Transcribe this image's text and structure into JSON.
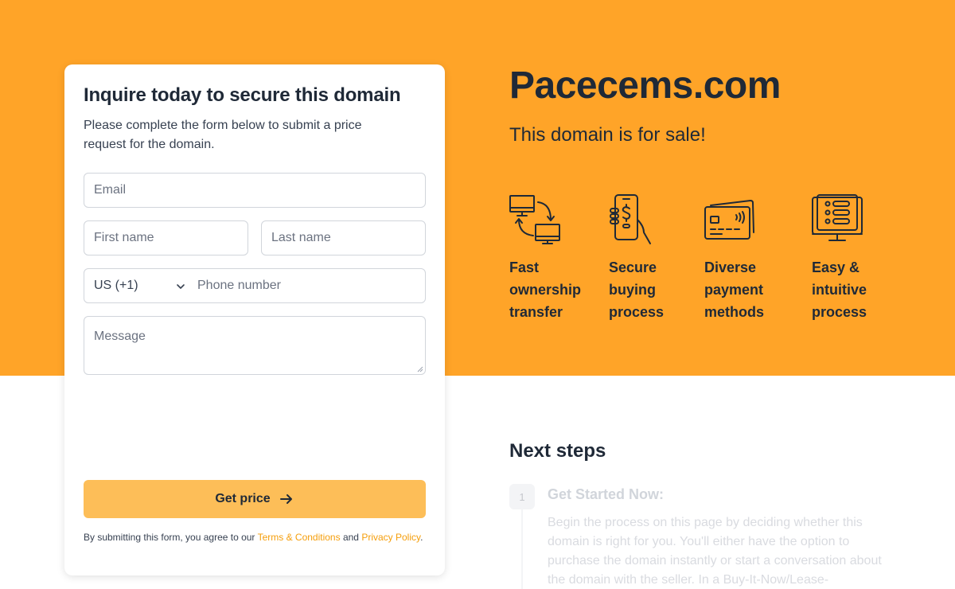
{
  "colors": {
    "hero": "#ffa428",
    "button": "#fdbe58",
    "link": "#f59e0b",
    "text": "#1f2937"
  },
  "form": {
    "title": "Inquire today to secure this domain",
    "subtitle": "Please complete the form below to submit a price request for the domain.",
    "email_placeholder": "Email",
    "first_name_placeholder": "First name",
    "last_name_placeholder": "Last name",
    "country_code": "US (+1)",
    "phone_placeholder": "Phone number",
    "message_placeholder": "Message",
    "submit_label": "Get price",
    "legal": {
      "prefix": "By submitting this form, you agree to our ",
      "terms": "Terms & Conditions",
      "and": " and ",
      "privacy": "Privacy Policy",
      "suffix": "."
    }
  },
  "hero": {
    "domain": "Pacecems.com",
    "tagline": "This domain is for sale!",
    "features": [
      {
        "icon": "transfer-icon",
        "label": "Fast ownership transfer"
      },
      {
        "icon": "secure-phone-icon",
        "label": "Secure buying process"
      },
      {
        "icon": "credit-card-icon",
        "label": "Diverse payment methods"
      },
      {
        "icon": "monitor-list-icon",
        "label": "Easy & intuitive process"
      }
    ]
  },
  "next_steps": {
    "title": "Next steps",
    "steps": [
      {
        "number": "1",
        "title": "Get Started Now:",
        "body": "Begin the process on this page by deciding whether this domain is right for you. You'll either have the option to purchase the domain instantly or start a conversation about the domain with the seller. In a Buy-It-Now/Lease-"
      }
    ]
  }
}
